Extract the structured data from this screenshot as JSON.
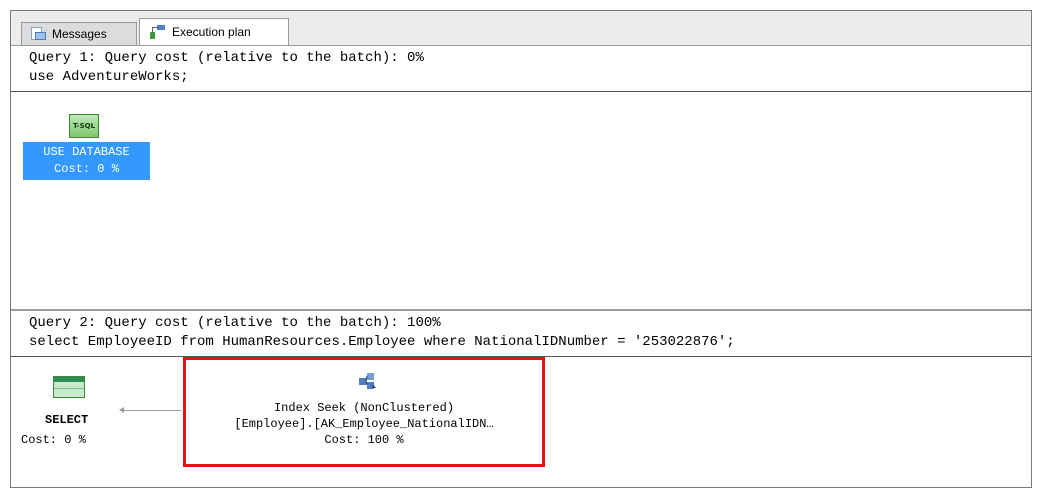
{
  "tabs": [
    {
      "label": "Messages",
      "icon": "messages-icon"
    },
    {
      "label": "Execution plan",
      "icon": "execution-plan-icon"
    }
  ],
  "query1": {
    "header": "Query 1: Query cost (relative to the batch): 0%",
    "sql": "use AdventureWorks;",
    "node": {
      "icon_text": "T-SQL",
      "label": "USE DATABASE",
      "cost": "Cost: 0 %"
    }
  },
  "query2": {
    "header": "Query 2: Query cost (relative to the batch): 100%",
    "sql": "select EmployeeID from HumanResources.Employee where NationalIDNumber = '253022876';",
    "select_node": {
      "label": "SELECT",
      "cost": "Cost: 0 %"
    },
    "seek_node": {
      "title": "Index Seek (NonClustered)",
      "object": "[Employee].[AK_Employee_NationalIDN…",
      "cost": "Cost: 100 %"
    }
  },
  "colors": {
    "selection": "#3399ff",
    "highlight": "#e51414"
  }
}
